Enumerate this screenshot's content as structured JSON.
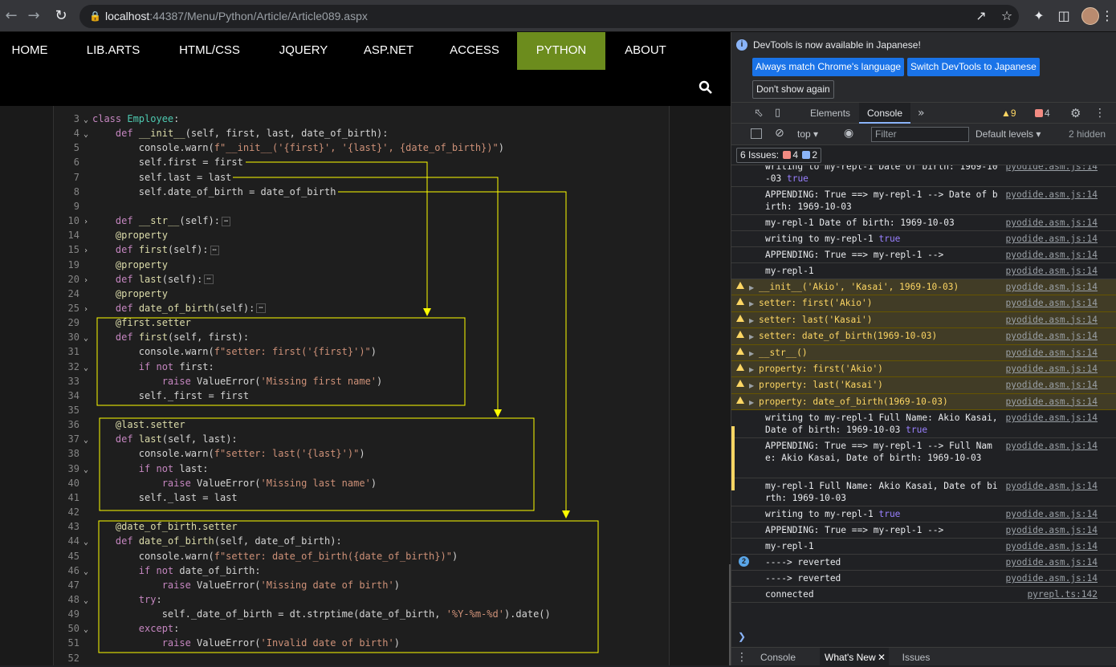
{
  "browser": {
    "url_host": "localhost",
    "url_rest": ":44387/Menu/Python/Article/Article089.aspx"
  },
  "site_nav": {
    "items": [
      "HOME",
      "LIB.ARTS",
      "HTML/CSS",
      "JQUERY",
      "ASP.NET",
      "ACCESS",
      "PYTHON",
      "ABOUT"
    ],
    "active": "PYTHON",
    "active_color": "#6c8c1d"
  },
  "code": {
    "line_numbers": [
      "3",
      "4",
      "5",
      "6",
      "7",
      "8",
      "9",
      "10",
      "14",
      "15",
      "19",
      "20",
      "24",
      "25",
      "29",
      "30",
      "31",
      "32",
      "33",
      "34",
      "35",
      "36",
      "37",
      "38",
      "39",
      "40",
      "41",
      "42",
      "43",
      "44",
      "45",
      "46",
      "47",
      "48",
      "49",
      "50",
      "51",
      "52"
    ],
    "lines": [
      "class Employee:",
      "    def __init__(self, first, last, date_of_birth):",
      "        console.warn(f\"__init__('{first}', '{last}', {date_of_birth})\")",
      "        self.first = first",
      "        self.last = last",
      "        self.date_of_birth = date_of_birth",
      "",
      "    def __str__(self):",
      "    @property",
      "    def first(self):",
      "    @property",
      "    def last(self):",
      "    @property",
      "    def date_of_birth(self):",
      "    @first.setter",
      "    def first(self, first):",
      "        console.warn(f\"setter: first('{first}')\")",
      "        if not first:",
      "            raise ValueError('Missing first name')",
      "        self._first = first",
      "",
      "    @last.setter",
      "    def last(self, last):",
      "        console.warn(f\"setter: last('{last}')\")",
      "        if not last:",
      "            raise ValueError('Missing last name')",
      "        self._last = last",
      "",
      "    @date_of_birth.setter",
      "    def date_of_birth(self, date_of_birth):",
      "        console.warn(f\"setter: date_of_birth({date_of_birth})\")",
      "        if not date_of_birth:",
      "            raise ValueError('Missing date of birth')",
      "        try:",
      "            self._date_of_birth = dt.strptime(date_of_birth, '%Y-%m-%d').date()",
      "        except:",
      "            raise ValueError('Invalid date of birth')",
      ""
    ]
  },
  "devtools": {
    "info_text": "DevTools is now available in Japanese!",
    "btn_match": "Always match Chrome's language",
    "btn_switch": "Switch DevTools to Japanese",
    "btn_dont_show": "Don't show again",
    "tabs": [
      "Elements",
      "Console"
    ],
    "active_tab": "Console",
    "warn_count": "9",
    "error_count": "4",
    "context": "top",
    "filter_placeholder": "Filter",
    "levels": "Default levels",
    "hidden": "2 hidden",
    "issues_label": "6 Issues:",
    "issues_errors": "4",
    "issues_info": "2",
    "messages": [
      {
        "type": "log",
        "text": "writing to my-repl-1 Date of birth: 1969-10-03",
        "tail": "true",
        "src": "pyodide.asm.js:14"
      },
      {
        "type": "log",
        "text": "APPENDING: True ==> my-repl-1 --> Date of birth: 1969-10-03",
        "src": "pyodide.asm.js:14"
      },
      {
        "type": "log",
        "text": "my-repl-1 Date of birth: 1969-10-03",
        "src": "pyodide.asm.js:14"
      },
      {
        "type": "log",
        "text": "writing to my-repl-1",
        "tail": "true",
        "src": "pyodide.asm.js:14"
      },
      {
        "type": "log",
        "text": "APPENDING: True ==> my-repl-1 -->",
        "src": "pyodide.asm.js:14"
      },
      {
        "type": "log",
        "text": "my-repl-1",
        "src": "pyodide.asm.js:14"
      },
      {
        "type": "warn",
        "text": "__init__('Akio', 'Kasai', 1969-10-03)",
        "src": "pyodide.asm.js:14"
      },
      {
        "type": "warn",
        "text": "setter: first('Akio')",
        "src": "pyodide.asm.js:14"
      },
      {
        "type": "warn",
        "text": "setter: last('Kasai')",
        "src": "pyodide.asm.js:14"
      },
      {
        "type": "warn",
        "text": "setter: date_of_birth(1969-10-03)",
        "src": "pyodide.asm.js:14"
      },
      {
        "type": "warn",
        "text": "__str__()",
        "src": "pyodide.asm.js:14"
      },
      {
        "type": "warn",
        "text": "property: first('Akio')",
        "src": "pyodide.asm.js:14"
      },
      {
        "type": "warn",
        "text": "property: last('Kasai')",
        "src": "pyodide.asm.js:14"
      },
      {
        "type": "warn",
        "text": "property: date_of_birth(1969-10-03)",
        "src": "pyodide.asm.js:14"
      },
      {
        "type": "log",
        "text": "writing to my-repl-1 Full Name: Akio Kasai, Date of birth: 1969-10-03",
        "tail": "true",
        "src": "pyodide.asm.js:14"
      },
      {
        "type": "log",
        "text": "APPENDING: True ==> my-repl-1 --> Full Name: Akio Kasai, Date of birth: 1969-10-03",
        "src": "pyodide.asm.js:14"
      },
      {
        "type": "log",
        "text": "my-repl-1 Full Name: Akio Kasai, Date of birth: 1969-10-03",
        "src": "pyodide.asm.js:14"
      },
      {
        "type": "log",
        "text": "writing to my-repl-1",
        "tail": "true",
        "src": "pyodide.asm.js:14"
      },
      {
        "type": "log",
        "text": "APPENDING: True ==> my-repl-1 -->",
        "src": "pyodide.asm.js:14"
      },
      {
        "type": "log",
        "text": "my-repl-1",
        "src": "pyodide.asm.js:14"
      },
      {
        "type": "log",
        "count": "2",
        "text": "----> reverted",
        "src": "pyodide.asm.js:14"
      },
      {
        "type": "log",
        "text": "----> reverted",
        "src": "pyodide.asm.js:14"
      },
      {
        "type": "log",
        "text": "connected",
        "src": "pyrepl.ts:142"
      }
    ],
    "drawer_tabs": [
      "Console",
      "What's New",
      "Issues"
    ],
    "drawer_active": "What's New"
  }
}
